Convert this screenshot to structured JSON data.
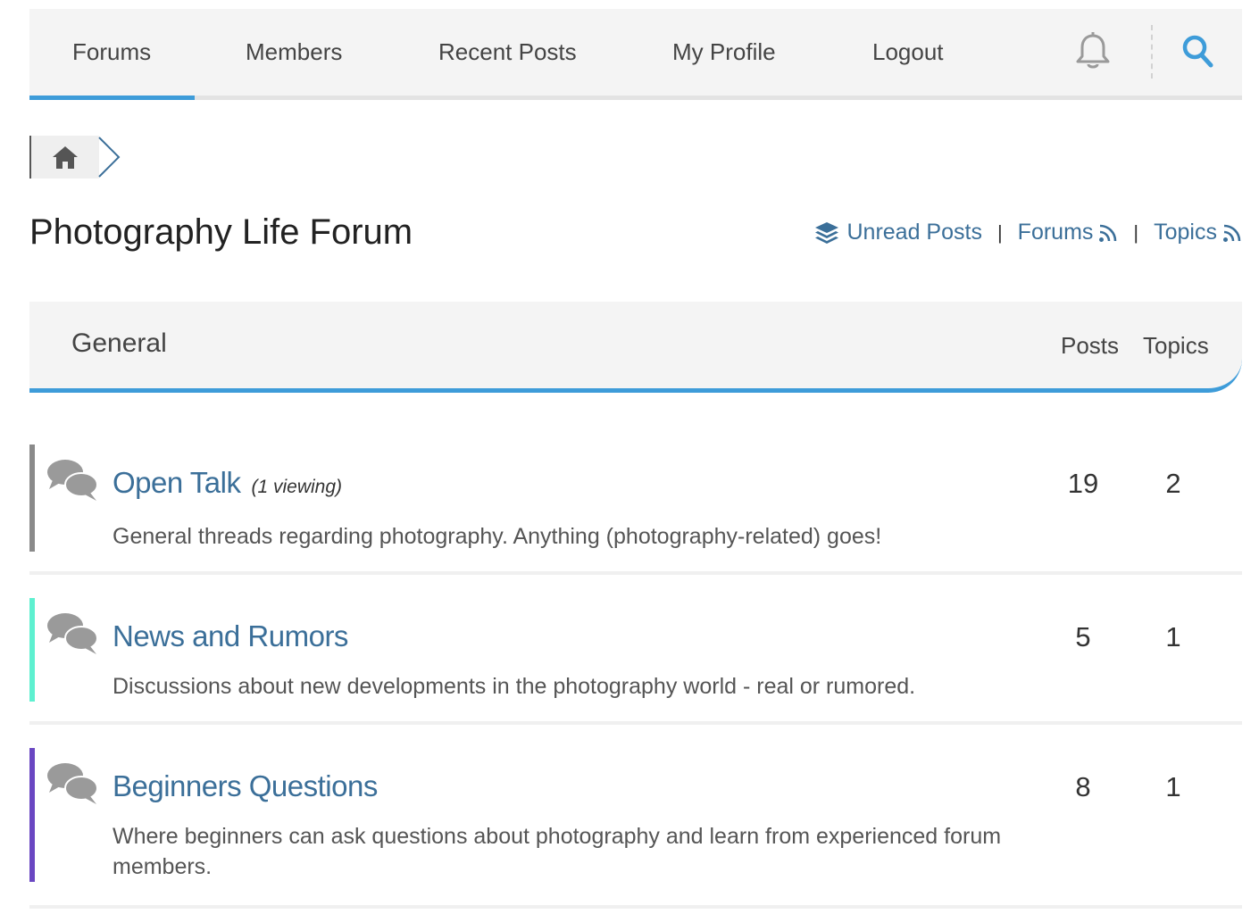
{
  "nav": {
    "items": [
      {
        "label": "Forums",
        "active": true
      },
      {
        "label": "Members"
      },
      {
        "label": "Recent Posts"
      },
      {
        "label": "My Profile"
      },
      {
        "label": "Logout"
      }
    ],
    "icons": [
      "bell-icon",
      "search-icon"
    ]
  },
  "breadcrumb": {
    "home_icon": "home-icon"
  },
  "page": {
    "title": "Photography Life Forum"
  },
  "links": {
    "unread": "Unread Posts",
    "forums": "Forums",
    "topics": "Topics",
    "separator": "|"
  },
  "category": {
    "name": "General",
    "col_posts": "Posts",
    "col_topics": "Topics"
  },
  "forums": [
    {
      "name": "Open Talk",
      "viewing": "(1 viewing)",
      "description": "General threads regarding photography. Anything (photography-related) goes!",
      "posts": "19",
      "topics": "2",
      "color": "#8a8a8a"
    },
    {
      "name": "News and Rumors",
      "viewing": "",
      "description": "Discussions about new developments in the photography world - real or rumored.",
      "posts": "5",
      "topics": "1",
      "color": "#5ef0d0"
    },
    {
      "name": "Beginners Questions",
      "viewing": "",
      "description": "Where beginners can ask questions about photography and learn from experienced forum members.",
      "posts": "8",
      "topics": "1",
      "color": "#6a47c2"
    }
  ],
  "colors": {
    "accent": "#3e9cd9",
    "link": "#3b6f99",
    "nav_bg": "#f4f4f4"
  }
}
